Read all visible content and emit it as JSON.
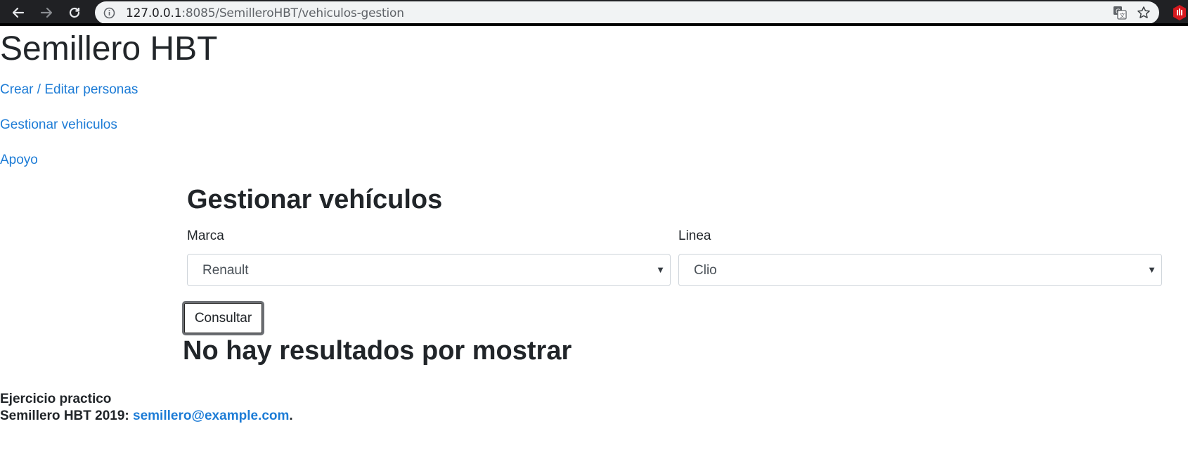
{
  "browser": {
    "url_host": "127.0.0.1",
    "url_rest": ":8085/SemilleroHBT/vehiculos-gestion"
  },
  "site": {
    "title": "Semillero HBT"
  },
  "nav": {
    "links": [
      {
        "label": "Crear / Editar personas"
      },
      {
        "label": "Gestionar vehiculos"
      },
      {
        "label": "Apoyo"
      }
    ]
  },
  "main": {
    "heading": "Gestionar vehículos",
    "marca": {
      "label": "Marca",
      "selected": "Renault"
    },
    "linea": {
      "label": "Linea",
      "selected": "Clio"
    },
    "submit_label": "Consultar",
    "results_message": "No hay resultados por mostrar"
  },
  "footer": {
    "line1": "Ejercicio practico",
    "line2_prefix": "Semillero HBT 2019: ",
    "email": "semillero@example.com",
    "line2_suffix": "."
  },
  "icons": [
    "back-icon",
    "forward-icon",
    "reload-icon",
    "info-icon",
    "translate-icon",
    "star-icon",
    "extension-icon"
  ],
  "colors": {
    "link": "#1d7cd6",
    "text": "#212529",
    "chrome": "#202124"
  }
}
